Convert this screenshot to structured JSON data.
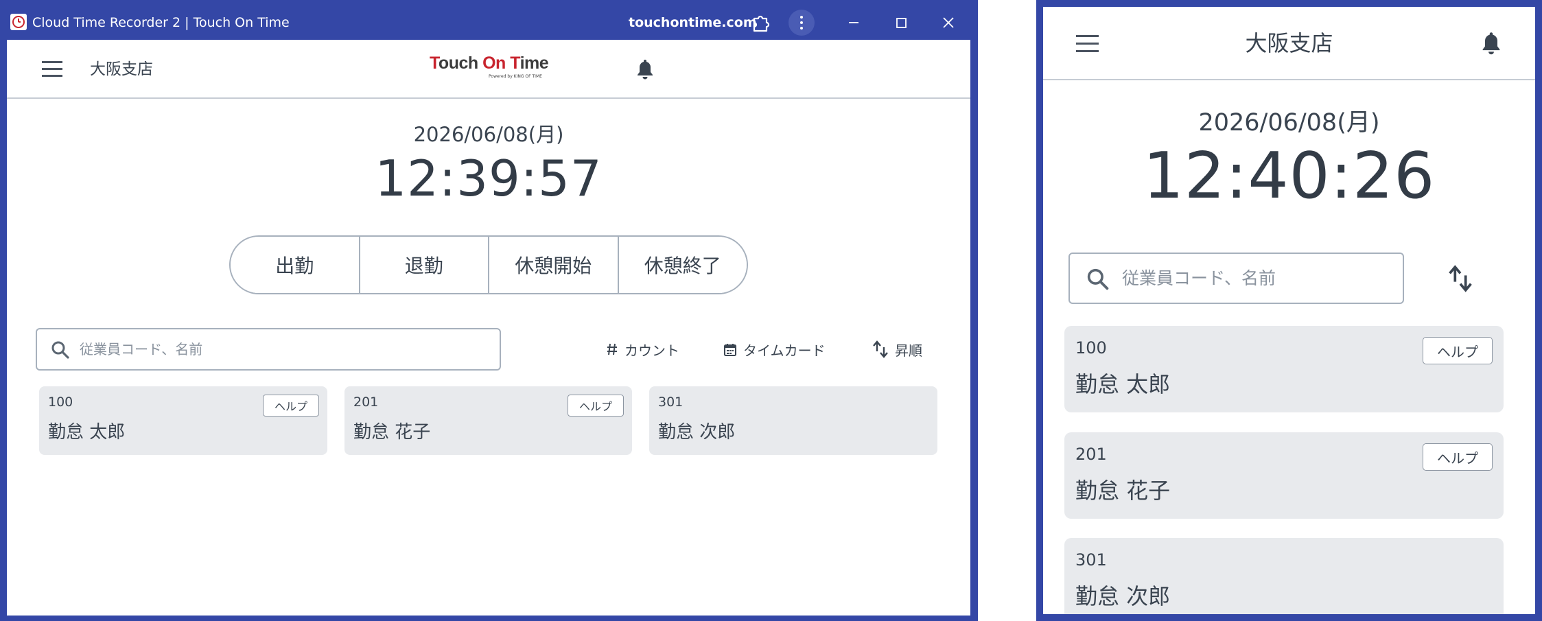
{
  "window": {
    "title": "Cloud Time Recorder 2 | Touch On Time",
    "domain": "touchontime.com"
  },
  "desktop": {
    "store_name": "大阪支店",
    "logo": {
      "text_prefix": "T",
      "text_mid": "ouch ",
      "text_on": "On ",
      "text_t": "T",
      "text_end": "ime",
      "powered": "Powered by KING OF TIME"
    },
    "date": "2026/06/08(月)",
    "time": "12:39:57",
    "punch_buttons": [
      "出勤",
      "退勤",
      "休憩開始",
      "休憩終了"
    ],
    "search": {
      "placeholder": "従業員コード、名前"
    },
    "tools": {
      "count_label": "カウント",
      "timecard_label": "タイムカード",
      "sort_label": "昇順"
    },
    "employees": [
      {
        "code": "100",
        "name": "勤怠 太郎",
        "help": "ヘルプ"
      },
      {
        "code": "201",
        "name": "勤怠 花子",
        "help": "ヘルプ"
      },
      {
        "code": "301",
        "name": "勤怠 次郎"
      }
    ]
  },
  "mobile": {
    "store_name": "大阪支店",
    "date": "2026/06/08(月)",
    "time": "12:40:26",
    "search": {
      "placeholder": "従業員コード、名前"
    },
    "employees": [
      {
        "code": "100",
        "name": "勤怠 太郎",
        "help": "ヘルプ"
      },
      {
        "code": "201",
        "name": "勤怠 花子",
        "help": "ヘルプ"
      },
      {
        "code": "301",
        "name": "勤怠 次郎"
      }
    ]
  },
  "colors": {
    "window_frame": "#3447a6",
    "card_background": "#e8eaed",
    "logo_red": "#c8242e",
    "text": "#3a4450"
  },
  "icons": {
    "menu": "hamburger-icon",
    "notifications": "bell-icon",
    "search": "search-icon",
    "count": "hash-icon",
    "timecard": "calendar-icon",
    "sort": "sort-arrows-icon",
    "extensions": "puzzle-icon"
  }
}
